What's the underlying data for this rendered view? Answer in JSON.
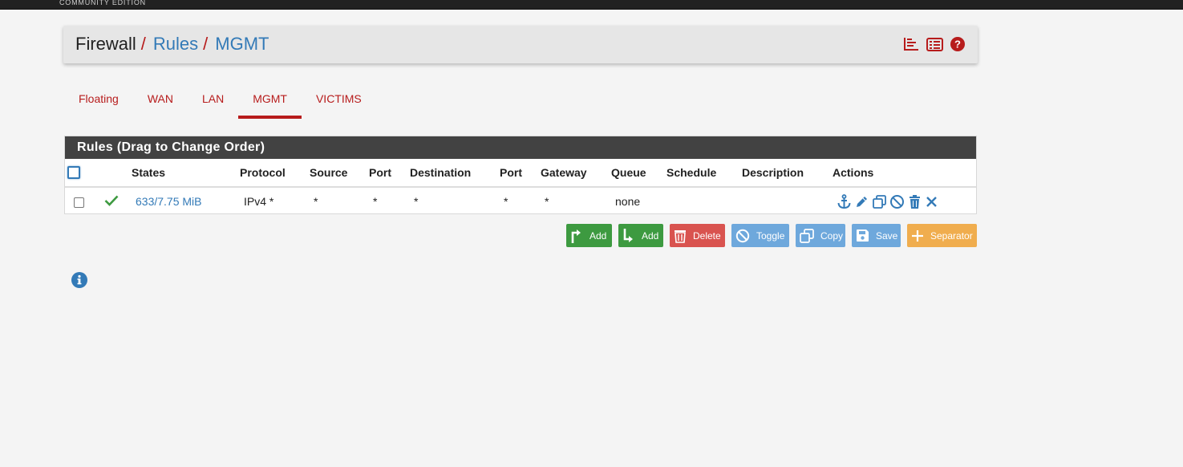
{
  "topbar": {
    "edition": "COMMUNITY EDITION"
  },
  "breadcrumb": {
    "items": [
      "Firewall",
      "Rules",
      "MGMT"
    ],
    "separator": "/"
  },
  "header_icons": [
    "chart-icon",
    "list-icon",
    "help-icon"
  ],
  "tabs": [
    {
      "label": "Floating",
      "active": false
    },
    {
      "label": "WAN",
      "active": false
    },
    {
      "label": "LAN",
      "active": false
    },
    {
      "label": "MGMT",
      "active": true
    },
    {
      "label": "VICTIMS",
      "active": false
    }
  ],
  "panel": {
    "title": "Rules (Drag to Change Order)"
  },
  "table": {
    "columns": [
      "",
      "",
      "States",
      "Protocol",
      "Source",
      "Port",
      "Destination",
      "Port",
      "Gateway",
      "Queue",
      "Schedule",
      "Description",
      "Actions"
    ],
    "rows": [
      {
        "status_icon": "check-icon",
        "states": "633/7.75 MiB",
        "protocol": "IPv4 *",
        "source": "*",
        "source_port": "*",
        "destination": "*",
        "destination_port": "*",
        "gateway": "*",
        "queue": "none",
        "schedule": "",
        "description": "",
        "actions": [
          "anchor-icon",
          "pencil-icon",
          "copy-icon",
          "disable-icon",
          "trash-icon",
          "delete-x-icon"
        ]
      }
    ]
  },
  "buttons": {
    "add_top": "Add",
    "add_bottom": "Add",
    "delete": "Delete",
    "toggle": "Toggle",
    "copy": "Copy",
    "save": "Save",
    "separator": "Separator"
  },
  "colors": {
    "accent_red": "#b71c1c",
    "link_blue": "#337ab7",
    "success_green": "#3d9a40",
    "danger_red": "#d9534f",
    "info_blue": "#6ea8dc",
    "warning_orange": "#f0ad4e",
    "panel_header": "#424242"
  }
}
